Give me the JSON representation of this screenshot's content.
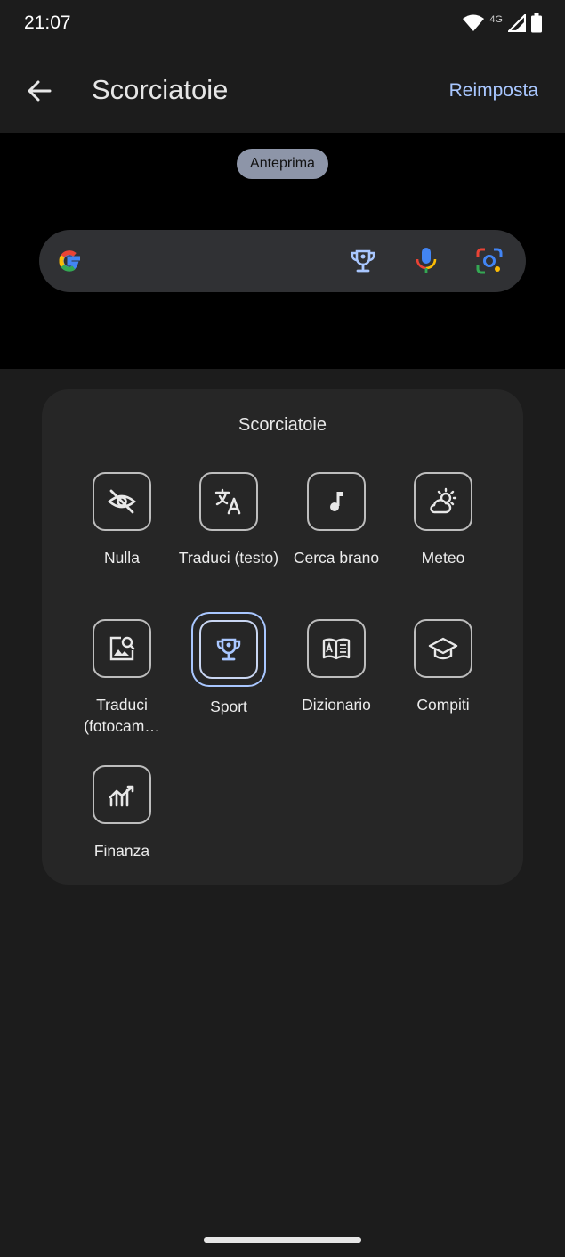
{
  "status_bar": {
    "time": "21:07",
    "network": "4G",
    "icons": [
      "wifi-icon",
      "signal-icon",
      "battery-icon"
    ]
  },
  "app_bar": {
    "back_icon": "arrow-back-icon",
    "title": "Scorciatoie",
    "reset_label": "Reimposta"
  },
  "preview": {
    "chip_label": "Anteprima",
    "search_bar": {
      "logo": "google-g-icon",
      "icons": [
        "trophy-icon",
        "microphone-icon",
        "lens-icon"
      ]
    }
  },
  "panel": {
    "title": "Scorciatoie",
    "selected": "Sport",
    "items": [
      {
        "label": "Nulla",
        "icon": "eye-off-icon"
      },
      {
        "label": "Traduci (testo)",
        "icon": "translate-icon"
      },
      {
        "label": "Cerca brano",
        "icon": "music-note-icon"
      },
      {
        "label": "Meteo",
        "icon": "weather-icon"
      },
      {
        "label": "Traduci (fotocam…",
        "icon": "image-search-icon"
      },
      {
        "label": "Sport",
        "icon": "trophy-icon"
      },
      {
        "label": "Dizionario",
        "icon": "dictionary-icon"
      },
      {
        "label": "Compiti",
        "icon": "school-icon"
      },
      {
        "label": "Finanza",
        "icon": "finance-chart-icon"
      }
    ]
  },
  "colors": {
    "background": "#1c1c1c",
    "panel": "#262626",
    "accent": "#a9c7ff",
    "preview_bg": "#000000"
  }
}
